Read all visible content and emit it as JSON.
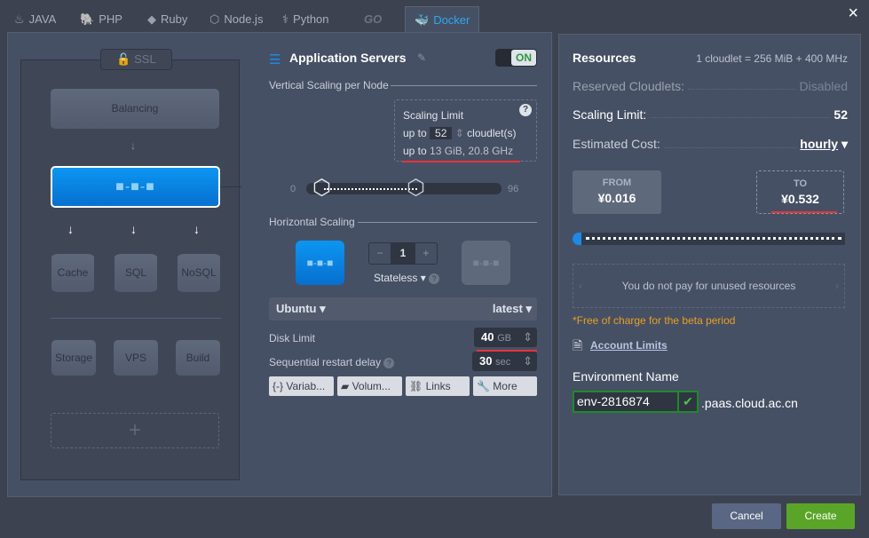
{
  "tabs": [
    {
      "label": "JAVA",
      "icon": "java-icon"
    },
    {
      "label": "PHP",
      "icon": "php-icon"
    },
    {
      "label": "Ruby",
      "icon": "ruby-icon"
    },
    {
      "label": "Node.js",
      "icon": "nodejs-icon"
    },
    {
      "label": "Python",
      "icon": "python-icon"
    },
    {
      "label": "GO",
      "icon": "go-icon"
    },
    {
      "label": "Docker",
      "icon": "docker-icon",
      "active": true
    }
  ],
  "close": "×",
  "diagram": {
    "ssl": "SSL",
    "balancing": "Balancing",
    "cache": "Cache",
    "sql": "SQL",
    "nosql": "NoSQL",
    "storage": "Storage",
    "vps": "VPS",
    "build": "Build",
    "add": "+"
  },
  "app": {
    "title": "Application Servers",
    "toggle": "ON",
    "vertical": "Vertical Scaling per Node",
    "scaling_title": "Scaling Limit",
    "up_to": "up to",
    "limit": "52",
    "cloudlets": "cloudlet(s)",
    "up_to2": "up to",
    "limit_res": "13 GiB, 20.8 GHz",
    "slider_min": "0",
    "slider_max": "96",
    "reserved": 1,
    "limit_value": 52,
    "horizontal": "Horizontal Scaling",
    "minus": "−",
    "count": "1",
    "plus": "+",
    "stateless": "Stateless",
    "image": "Ubuntu",
    "tag": "latest",
    "disk_label": "Disk Limit",
    "disk": "40",
    "disk_unit": "GB",
    "restart_label": "Sequential restart delay",
    "restart": "30",
    "restart_unit": "sec",
    "buttons": [
      "Variab...",
      "Volum...",
      "Links",
      "More"
    ]
  },
  "resources": {
    "title": "Resources",
    "cloudlet_eq": "1 cloudlet = 256 MiB + 400 MHz",
    "reserved_label": "Reserved Cloudlets:",
    "reserved": "Disabled",
    "scaling_label": "Scaling Limit:",
    "scaling": "52",
    "cost_label": "Estimated Cost:",
    "period": "hourly",
    "from_label": "FROM",
    "from": "¥0.016",
    "to_label": "TO",
    "to": "¥0.532",
    "tip": "You do not pay for unused resources",
    "free": "*Free of charge for the beta period",
    "account_limits": "Account Limits",
    "env_label": "Environment Name",
    "env": "env-2816874",
    "domain": ".paas.cloud.ac.cn"
  },
  "footer": {
    "cancel": "Cancel",
    "create": "Create"
  },
  "colors": {
    "accent": "#1a8ae8",
    "create": "#5aa527",
    "warning": "#e8a020",
    "highlight": "#e8333a"
  }
}
